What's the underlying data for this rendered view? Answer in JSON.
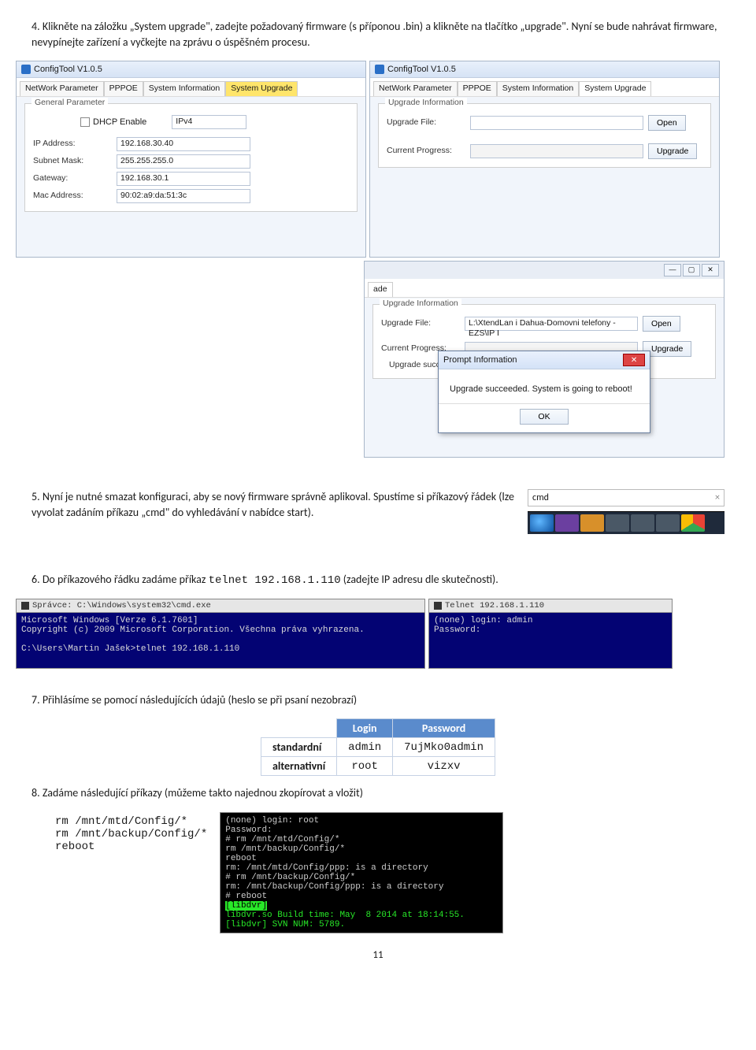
{
  "step4": {
    "num": "4.",
    "text": "Klikněte na záložku „System upgrade\", zadejte požadovaný firmware (s příponou .bin) a klikněte na tlačítko „upgrade\". Nyní se bude nahrávat firmware, nevypínejte zařízení a vyčkejte na zprávu o úspěšném procesu."
  },
  "leftWin": {
    "title": "ConfigTool V1.0.5",
    "tabs": [
      "NetWork Parameter",
      "PPPOE",
      "System Information",
      "System Upgrade"
    ],
    "groupTitle": "General Parameter",
    "dhcp": "DHCP Enable",
    "ipver": "IPv4",
    "fields": {
      "ip_label": "IP Address:",
      "ip": "192.168.30.40",
      "mask_label": "Subnet Mask:",
      "mask": "255.255.255.0",
      "gw_label": "Gateway:",
      "gw": "192.168.30.1",
      "mac_label": "Mac Address:",
      "mac": "90:02:a9:da:51:3c"
    }
  },
  "rightWin": {
    "title": "ConfigTool V1.0.5",
    "tabs": [
      "NetWork Parameter",
      "PPPOE",
      "System Information",
      "System Upgrade"
    ],
    "groupTitle": "Upgrade Information",
    "file_label": "Upgrade File:",
    "open": "Open",
    "prog_label": "Current Progress:",
    "upgrade": "Upgrade"
  },
  "midWin": {
    "tabSuffix": "ade",
    "groupTitle": "Upgrade Information",
    "file_label": "Upgrade File:",
    "file_value": "L:\\XtendLan i Dahua-Domovni telefony - EZS\\IP I",
    "open": "Open",
    "prog_label": "Current Progress:",
    "upgrade": "Upgrade",
    "status": "Upgrade succeeded. System is going to reboot!",
    "dialog_title": "Prompt Information",
    "dialog_msg": "Upgrade succeeded. System is going to reboot!",
    "dialog_ok": "OK"
  },
  "step5": {
    "num": "5.",
    "text": "Nyní je nutné smazat konfiguraci, aby se nový firmware správně aplikoval. Spustíme si příkazový řádek (lze vyvolat zadáním příkazu „cmd\" do vyhledávání v nabídce start).",
    "cmd_search": "cmd"
  },
  "step6": {
    "num": "6.",
    "pre": "Do příkazového řádku zadáme příkaz ",
    "code": "telnet 192.168.1.110",
    "post": " (zadejte IP adresu dle skutečnosti)."
  },
  "cmdLeft": {
    "title": "Správce: C:\\Windows\\system32\\cmd.exe",
    "body": "Microsoft Windows [Verze 6.1.7601]\nCopyright (c) 2009 Microsoft Corporation. Všechna práva vyhrazena.\n\nC:\\Users\\Martin Jašek>telnet 192.168.1.110"
  },
  "cmdRight": {
    "title": "Telnet 192.168.1.110",
    "body": "(none) login: admin\nPassword:"
  },
  "step7": {
    "num": "7.",
    "text": "Přihlásíme se pomocí následujících údajů (heslo se při psaní nezobrazí)",
    "table": {
      "head_login": "Login",
      "head_password": "Password",
      "rows": [
        {
          "label": "standardní",
          "login": "admin",
          "pass": "7ujMko0admin"
        },
        {
          "label": "alternativní",
          "login": "root",
          "pass": "vizxv"
        }
      ]
    }
  },
  "step8": {
    "num": "8.",
    "text": "Zadáme následující příkazy (můžeme takto najednou zkopírovat a vložit)",
    "commands": [
      "rm /mnt/mtd/Config/*",
      "rm /mnt/backup/Config/*",
      "reboot"
    ],
    "console": "(none) login: root\nPassword:\n# rm /mnt/mtd/Config/*\nrm /mnt/backup/Config/*\nreboot\nrm: /mnt/mtd/Config/ppp: is a directory\n# rm /mnt/backup/Config/*\nrm: /mnt/backup/Config/ppp: is a directory\n# reboot",
    "console_green1": "[libdvr]",
    "console_green2": "libdvr.so Build time: May  8 2014 at 18:14:55.",
    "console_green3": "[libdvr] SVN NUM: 5789."
  },
  "pagenum": "11"
}
